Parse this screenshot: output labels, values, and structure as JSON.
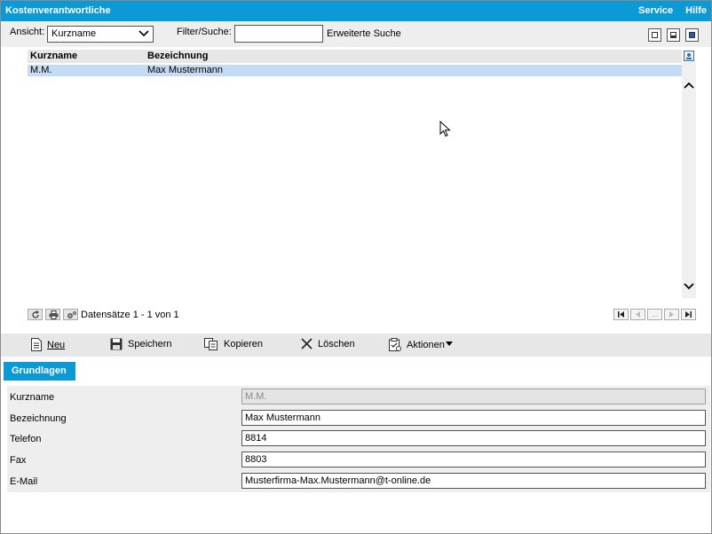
{
  "window": {
    "title": "Kostenverantwortliche",
    "menu": [
      "Service",
      "Hilfe"
    ]
  },
  "filter": {
    "view_label": "Ansicht:",
    "view_value": "Kurzname",
    "search_label": "Filter/Suche:",
    "search_value": "",
    "extended_search": "Erweiterte Suche"
  },
  "grid": {
    "columns": [
      "Kurzname",
      "Bezeichnung"
    ],
    "rows": [
      {
        "kurzname": "M.M.",
        "bezeichnung": "Max Mustermann"
      }
    ],
    "record_count": "Datensätze 1 - 1 von 1",
    "pager_ellipsis": "..."
  },
  "actions": {
    "new": "Neu",
    "save": "Speichern",
    "copy": "Kopieren",
    "delete": "Löschen",
    "actions": "Aktionen"
  },
  "tab": {
    "label": "Grundlagen"
  },
  "form": {
    "fields": [
      {
        "label": "Kurzname",
        "value": "M.M."
      },
      {
        "label": "Bezeichnung",
        "value": "Max Mustermann"
      },
      {
        "label": "Telefon",
        "value": "8814"
      },
      {
        "label": "Fax",
        "value": "8803"
      },
      {
        "label": "E-Mail",
        "value": "Musterfirma-Max.Mustermann@t-online.de"
      }
    ]
  },
  "colors": {
    "accent": "#0c9ad6",
    "selected_row": "#c5daf3",
    "panel": "#eeeeee"
  },
  "icons": [
    "chevron-down-icon",
    "layout-icons",
    "export-icon",
    "scroll-up-icon",
    "scroll-down-icon",
    "refresh-icon",
    "print-icon",
    "settings-icon",
    "document-icon",
    "save-icon",
    "copy-icon",
    "close-icon",
    "clipboard-icon",
    "mouse-cursor-icon"
  ]
}
